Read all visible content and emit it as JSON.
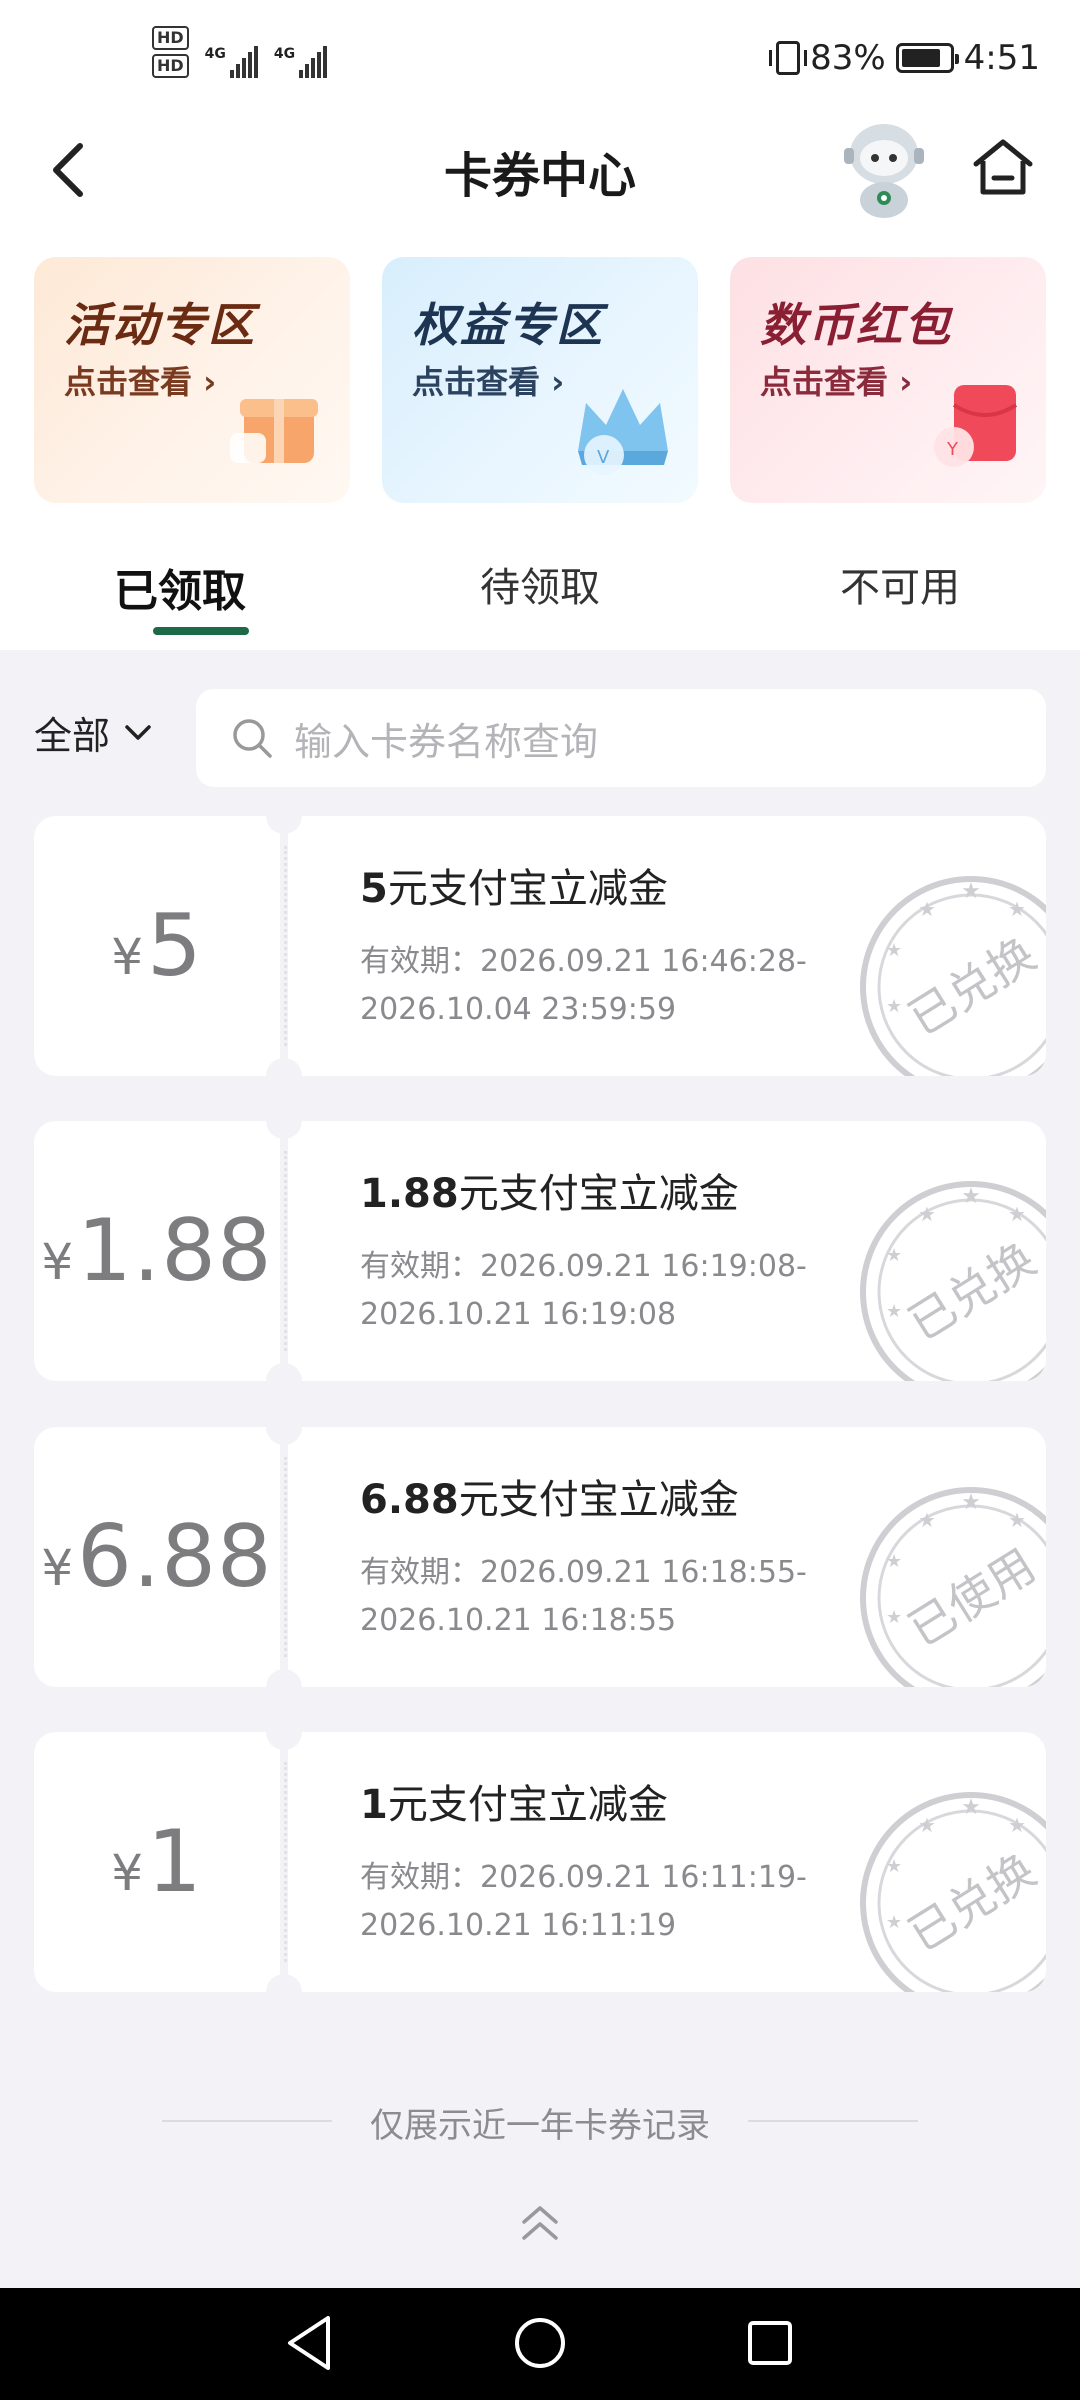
{
  "status_bar": {
    "battery": "83%",
    "time": "4:51",
    "hd1": "HD",
    "hd2": "HD",
    "net": "4G"
  },
  "header": {
    "title": "卡券中心"
  },
  "banners": [
    {
      "title": "活动专区",
      "sub": "点击查看 ›"
    },
    {
      "title": "权益专区",
      "sub": "点击查看 ›"
    },
    {
      "title": "数币红包",
      "sub": "点击查看 ›"
    }
  ],
  "tabs": [
    "已领取",
    "待领取",
    "不可用"
  ],
  "filter": {
    "label": "全部",
    "search_placeholder": "输入卡券名称查询"
  },
  "coupons": [
    {
      "currency": "¥",
      "amount": "5",
      "name_bold": "5",
      "name_rest": "元支付宝立减金",
      "date1": "有效期：2026.09.21 16:46:28-",
      "date2": "2026.10.04 23:59:59",
      "stamp": "已兑换"
    },
    {
      "currency": "¥",
      "amount": "1.88",
      "name_bold": "1.88",
      "name_rest": "元支付宝立减金",
      "date1": "有效期：2026.09.21 16:19:08-",
      "date2": "2026.10.21 16:19:08",
      "stamp": "已兑换"
    },
    {
      "currency": "¥",
      "amount": "6.88",
      "name_bold": "6.88",
      "name_rest": "元支付宝立减金",
      "date1": "有效期：2026.09.21 16:18:55-",
      "date2": "2026.10.21 16:18:55",
      "stamp": "已使用"
    },
    {
      "currency": "¥",
      "amount": "1",
      "name_bold": "1",
      "name_rest": "元支付宝立减金",
      "date1": "有效期：2026.09.21 16:11:19-",
      "date2": "2026.10.21 16:11:19",
      "stamp": "已兑换"
    }
  ],
  "footer": {
    "note": "仅展示近一年卡券记录"
  },
  "colors": {
    "accent": "#1d6b46",
    "background": "#f3f3f7",
    "muted_text": "#8a8a8e"
  }
}
